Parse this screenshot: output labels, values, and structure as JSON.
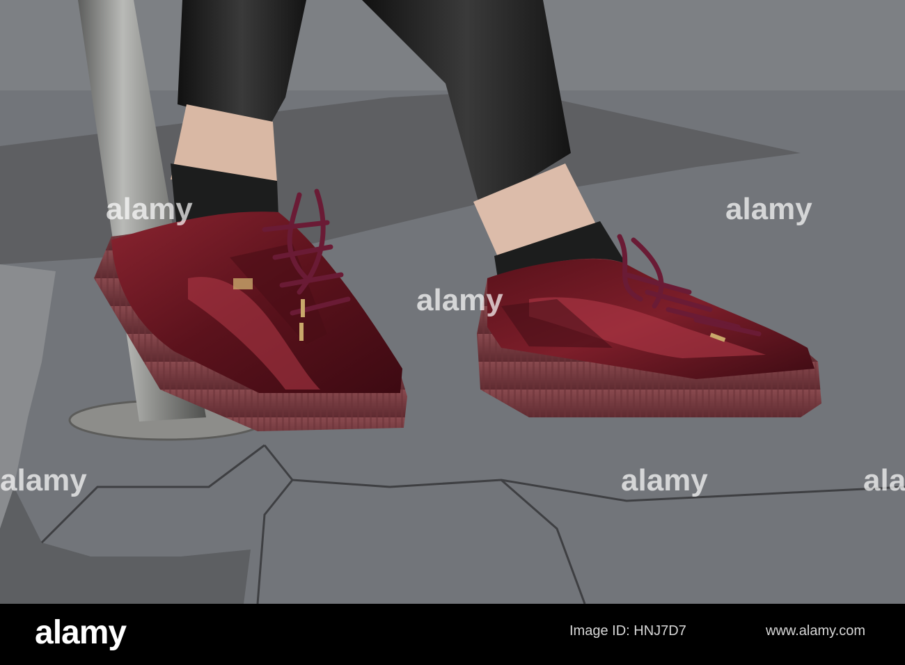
{
  "watermark": {
    "text": "alamy",
    "color": "#ffffff"
  },
  "footer": {
    "logo": "alamy",
    "image_id_label": "Image ID: HNJ7D7",
    "url": "www.alamy.com",
    "background": "#000000"
  },
  "colors": {
    "pavement": "#6f7276",
    "velvet_burgundy": "#6e1a24",
    "sole": "#7c3f44",
    "sock": "#1c1d1d",
    "leather_trousers": "#202020",
    "pole": "#9a9a98"
  }
}
